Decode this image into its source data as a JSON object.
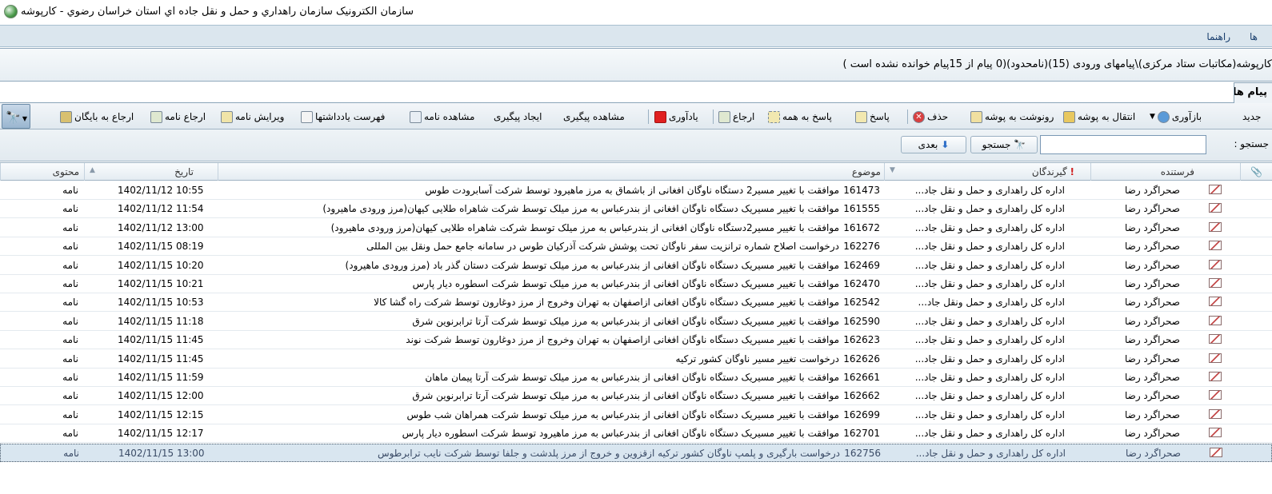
{
  "window": {
    "title": "سازمان الكترونيک سازمان راهداري و حمل و نقل جاده اي استان خراسان رضوي - کارپوشه"
  },
  "menubar": {
    "items": [
      "ها",
      "راهنما"
    ]
  },
  "path_info": "کارپوشه(مکاتبات ستاد مرکزی)\\پیامهای ورودی (15)(نامحدود)(0 پیام از 15پیام خوانده نشده است )",
  "tab": {
    "label": "پیام ها"
  },
  "toolbar": {
    "new": "جدید",
    "refresh": "بازآوری",
    "move_to_folder": "انتقال به پوشه",
    "copy_to_folder": "رونوشت به پوشه",
    "delete": "حذف",
    "reply": "پاسخ",
    "reply_all": "پاسخ به همه",
    "forward": "ارجاع",
    "reminder": "یادآوری",
    "view_followup": "مشاهده پیگیری",
    "create_followup": "ایجاد پیگیری",
    "view_letter": "مشاهده نامه",
    "notes_list": "فهرست یادداشتها",
    "edit_letter": "ویرایش نامه",
    "forward_letter": "ارجاع نامه",
    "forward_archive": "ارجاع به بایگان"
  },
  "search": {
    "label": "جستجو :",
    "value": "",
    "search_button": "جستجو",
    "next_button": "بعدی"
  },
  "columns": {
    "sender": "فرستنده",
    "recipients": "گیرندگان",
    "subject": "موضوع",
    "date": "تاریخ",
    "content": "محتوی"
  },
  "rows": [
    {
      "sender": "صحراگرد رضا",
      "recipients": "اداره کل راهداری و حمل و نقل جاد...",
      "number": "161473",
      "subject": "موافقت با تغییر مسیر2 دستگاه ناوگان افغانی از باشماق به  مرز ماهیرود توسط شرکت آسابرودت طوس",
      "date": "1402/11/12 10:55",
      "content": "نامه"
    },
    {
      "sender": "صحراگرد رضا",
      "recipients": "اداره کل راهداری و حمل و نقل جاد...",
      "number": "161555",
      "subject": "موافقت با تغییر مسیریک دستگاه ناوگان افغانی از بندرعباس به  مرز میلک توسط شرکت شاهراه طلایی کیهان(مرز ورودی ماهیرود)",
      "date": "1402/11/12 11:54",
      "content": "نامه"
    },
    {
      "sender": "صحراگرد رضا",
      "recipients": "اداره کل راهداری و حمل و نقل جاد...",
      "number": "161672",
      "subject": "موافقت با تغییر مسیر2دستگاه ناوگان افغانی از بندرعباس به  مرز میلک توسط شرکت شاهراه طلایی کیهان(مرز ورودی ماهیرود)",
      "date": "1402/11/12 13:00",
      "content": "نامه"
    },
    {
      "sender": "صحراگرد رضا",
      "recipients": "اداره کل راهداری و حمل و نقل جاد...",
      "number": "162276",
      "subject": "درخواست اصلاح شماره ترانزیت سفر ناوگان تحت پوشش  شرکت آذرکیان طوس در سامانه جامع حمل ونقل بین المللی",
      "date": "1402/11/15 08:19",
      "content": "نامه"
    },
    {
      "sender": "صحراگرد رضا",
      "recipients": "اداره کل راهداری و حمل و نقل جاد...",
      "number": "162469",
      "subject": "موافقت با تغییر مسیریک دستگاه ناوگان افغانی از بندرعباس به  مرز میلک توسط شرکت دستان گذر باد (مرز ورودی ماهیرود)",
      "date": "1402/11/15 10:20",
      "content": "نامه"
    },
    {
      "sender": "صحراگرد رضا",
      "recipients": "اداره کل راهداری و حمل و نقل جاد...",
      "number": "162470",
      "subject": "موافقت با تغییر مسیریک دستگاه ناوگان افغانی از بندرعباس به  مرز میلک توسط شرکت اسطوره دیار پارس",
      "date": "1402/11/15 10:21",
      "content": "نامه"
    },
    {
      "sender": "صحراگرد رضا",
      "recipients": "اداره کل راهداری و حمل ونقل جاد...",
      "number": "162542",
      "subject": "موافقت با تغییر مسیریک دستگاه ناوگان افغانی ازاصفهان به تهران وخروج از مرز دوغارون توسط شرکت راه گشا کالا",
      "date": "1402/11/15 10:53",
      "content": "نامه"
    },
    {
      "sender": "صحراگرد رضا",
      "recipients": "اداره کل راهداری و حمل و نقل جاد...",
      "number": "162590",
      "subject": "موافقت با تغییر مسیریک دستگاه ناوگان افغانی از بندرعباس به  مرز میلک توسط شرکت آرتا ترابرنوین شرق",
      "date": "1402/11/15 11:18",
      "content": "نامه"
    },
    {
      "sender": "صحراگرد رضا",
      "recipients": "اداره کل راهداری و حمل و نقل جاد...",
      "number": "162623",
      "subject": "موافقت با تغییر مسیریک دستگاه ناوگان افغانی ازاصفهان به تهران وخروج از مرز دوغارون توسط شرکت نوند",
      "date": "1402/11/15 11:45",
      "content": "نامه"
    },
    {
      "sender": "صحراگرد رضا",
      "recipients": "اداره کل راهداری و حمل و نقل جاد...",
      "number": "162626",
      "subject": "درخواست تغییر مسیر ناوگان کشور ترکیه",
      "date": "1402/11/15 11:45",
      "content": "نامه"
    },
    {
      "sender": "صحراگرد رضا",
      "recipients": "اداره کل راهداری و حمل و نقل جاد...",
      "number": "162661",
      "subject": "موافقت با تغییر مسیریک دستگاه ناوگان افغانی از بندرعباس به  مرز میلک توسط شرکت آرتا پیمان ماهان",
      "date": "1402/11/15 11:59",
      "content": "نامه"
    },
    {
      "sender": "صحراگرد رضا",
      "recipients": "اداره کل راهداری و حمل و نقل جاد...",
      "number": "162662",
      "subject": "موافقت با تغییر مسیریک دستگاه ناوگان افغانی از بندرعباس به  مرز میلک توسط شرکت آرتا ترابرنوین شرق",
      "date": "1402/11/15 12:00",
      "content": "نامه"
    },
    {
      "sender": "صحراگرد رضا",
      "recipients": "اداره کل راهداری و حمل و نقل جاد...",
      "number": "162699",
      "subject": "موافقت با تغییر مسیریک دستگاه ناوگان افغانی از بندرعباس به  مرز میلک توسط شرکت همراهان شب طوس",
      "date": "1402/11/15 12:15",
      "content": "نامه"
    },
    {
      "sender": "صحراگرد رضا",
      "recipients": "اداره کل راهداری و حمل و نقل جاد...",
      "number": "162701",
      "subject": "موافقت با تغییر مسیریک دستگاه ناوگان افغانی از بندرعباس به  مرز ماهیرود توسط شرکت اسطوره دیار پارس",
      "date": "1402/11/15 12:17",
      "content": "نامه"
    },
    {
      "sender": "صحراگرد رضا",
      "recipients": "اداره کل راهداری و حمل و نقل جاد...",
      "number": "162756",
      "subject": "درخواست بارگیری و پلمپ ناوگان کشور ترکیه ازقزوین و خروج از مرز پلدشت  و جلفا توسط شرکت نایب ترابرطوس",
      "date": "1402/11/15 13:00",
      "content": "نامه",
      "selected": true
    }
  ]
}
